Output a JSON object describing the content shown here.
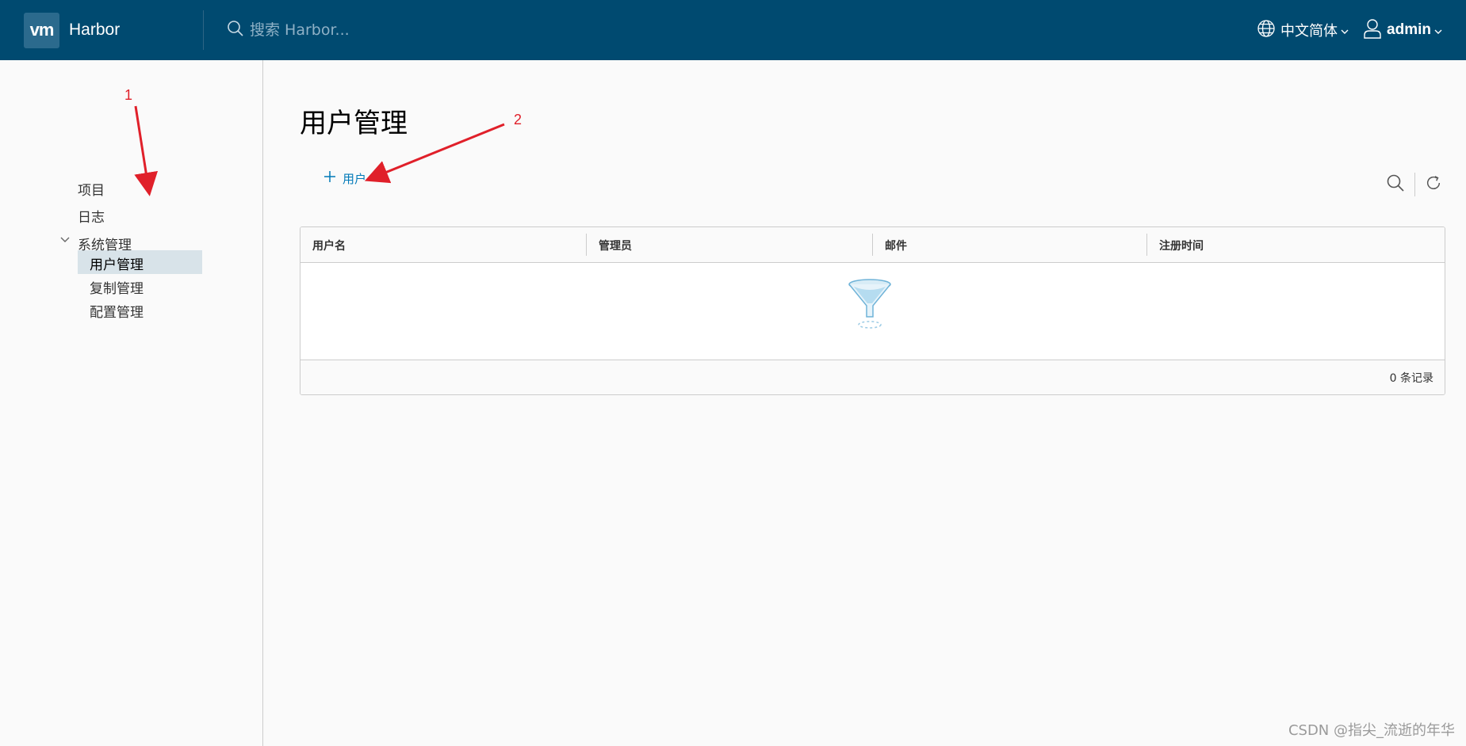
{
  "header": {
    "logo_text": "vm",
    "brand": "Harbor",
    "search_placeholder": "搜索 Harbor...",
    "language": "中文简体",
    "user": "admin",
    "bg_color": "#004a70"
  },
  "sidebar": {
    "items": [
      {
        "label": "项目"
      },
      {
        "label": "日志"
      },
      {
        "label": "系统管理",
        "expanded": true
      },
      {
        "label": "用户管理",
        "active": true
      },
      {
        "label": "复制管理"
      },
      {
        "label": "配置管理"
      }
    ]
  },
  "main": {
    "title": "用户管理",
    "add_label": "用户",
    "columns": [
      "用户名",
      "管理员",
      "邮件",
      "注册时间"
    ],
    "rows": [],
    "footer": "0 条记录"
  },
  "annotations": {
    "one": "1",
    "two": "2",
    "arrow_color": "#e0202a"
  },
  "watermark": "CSDN @指尖_流逝的年华"
}
